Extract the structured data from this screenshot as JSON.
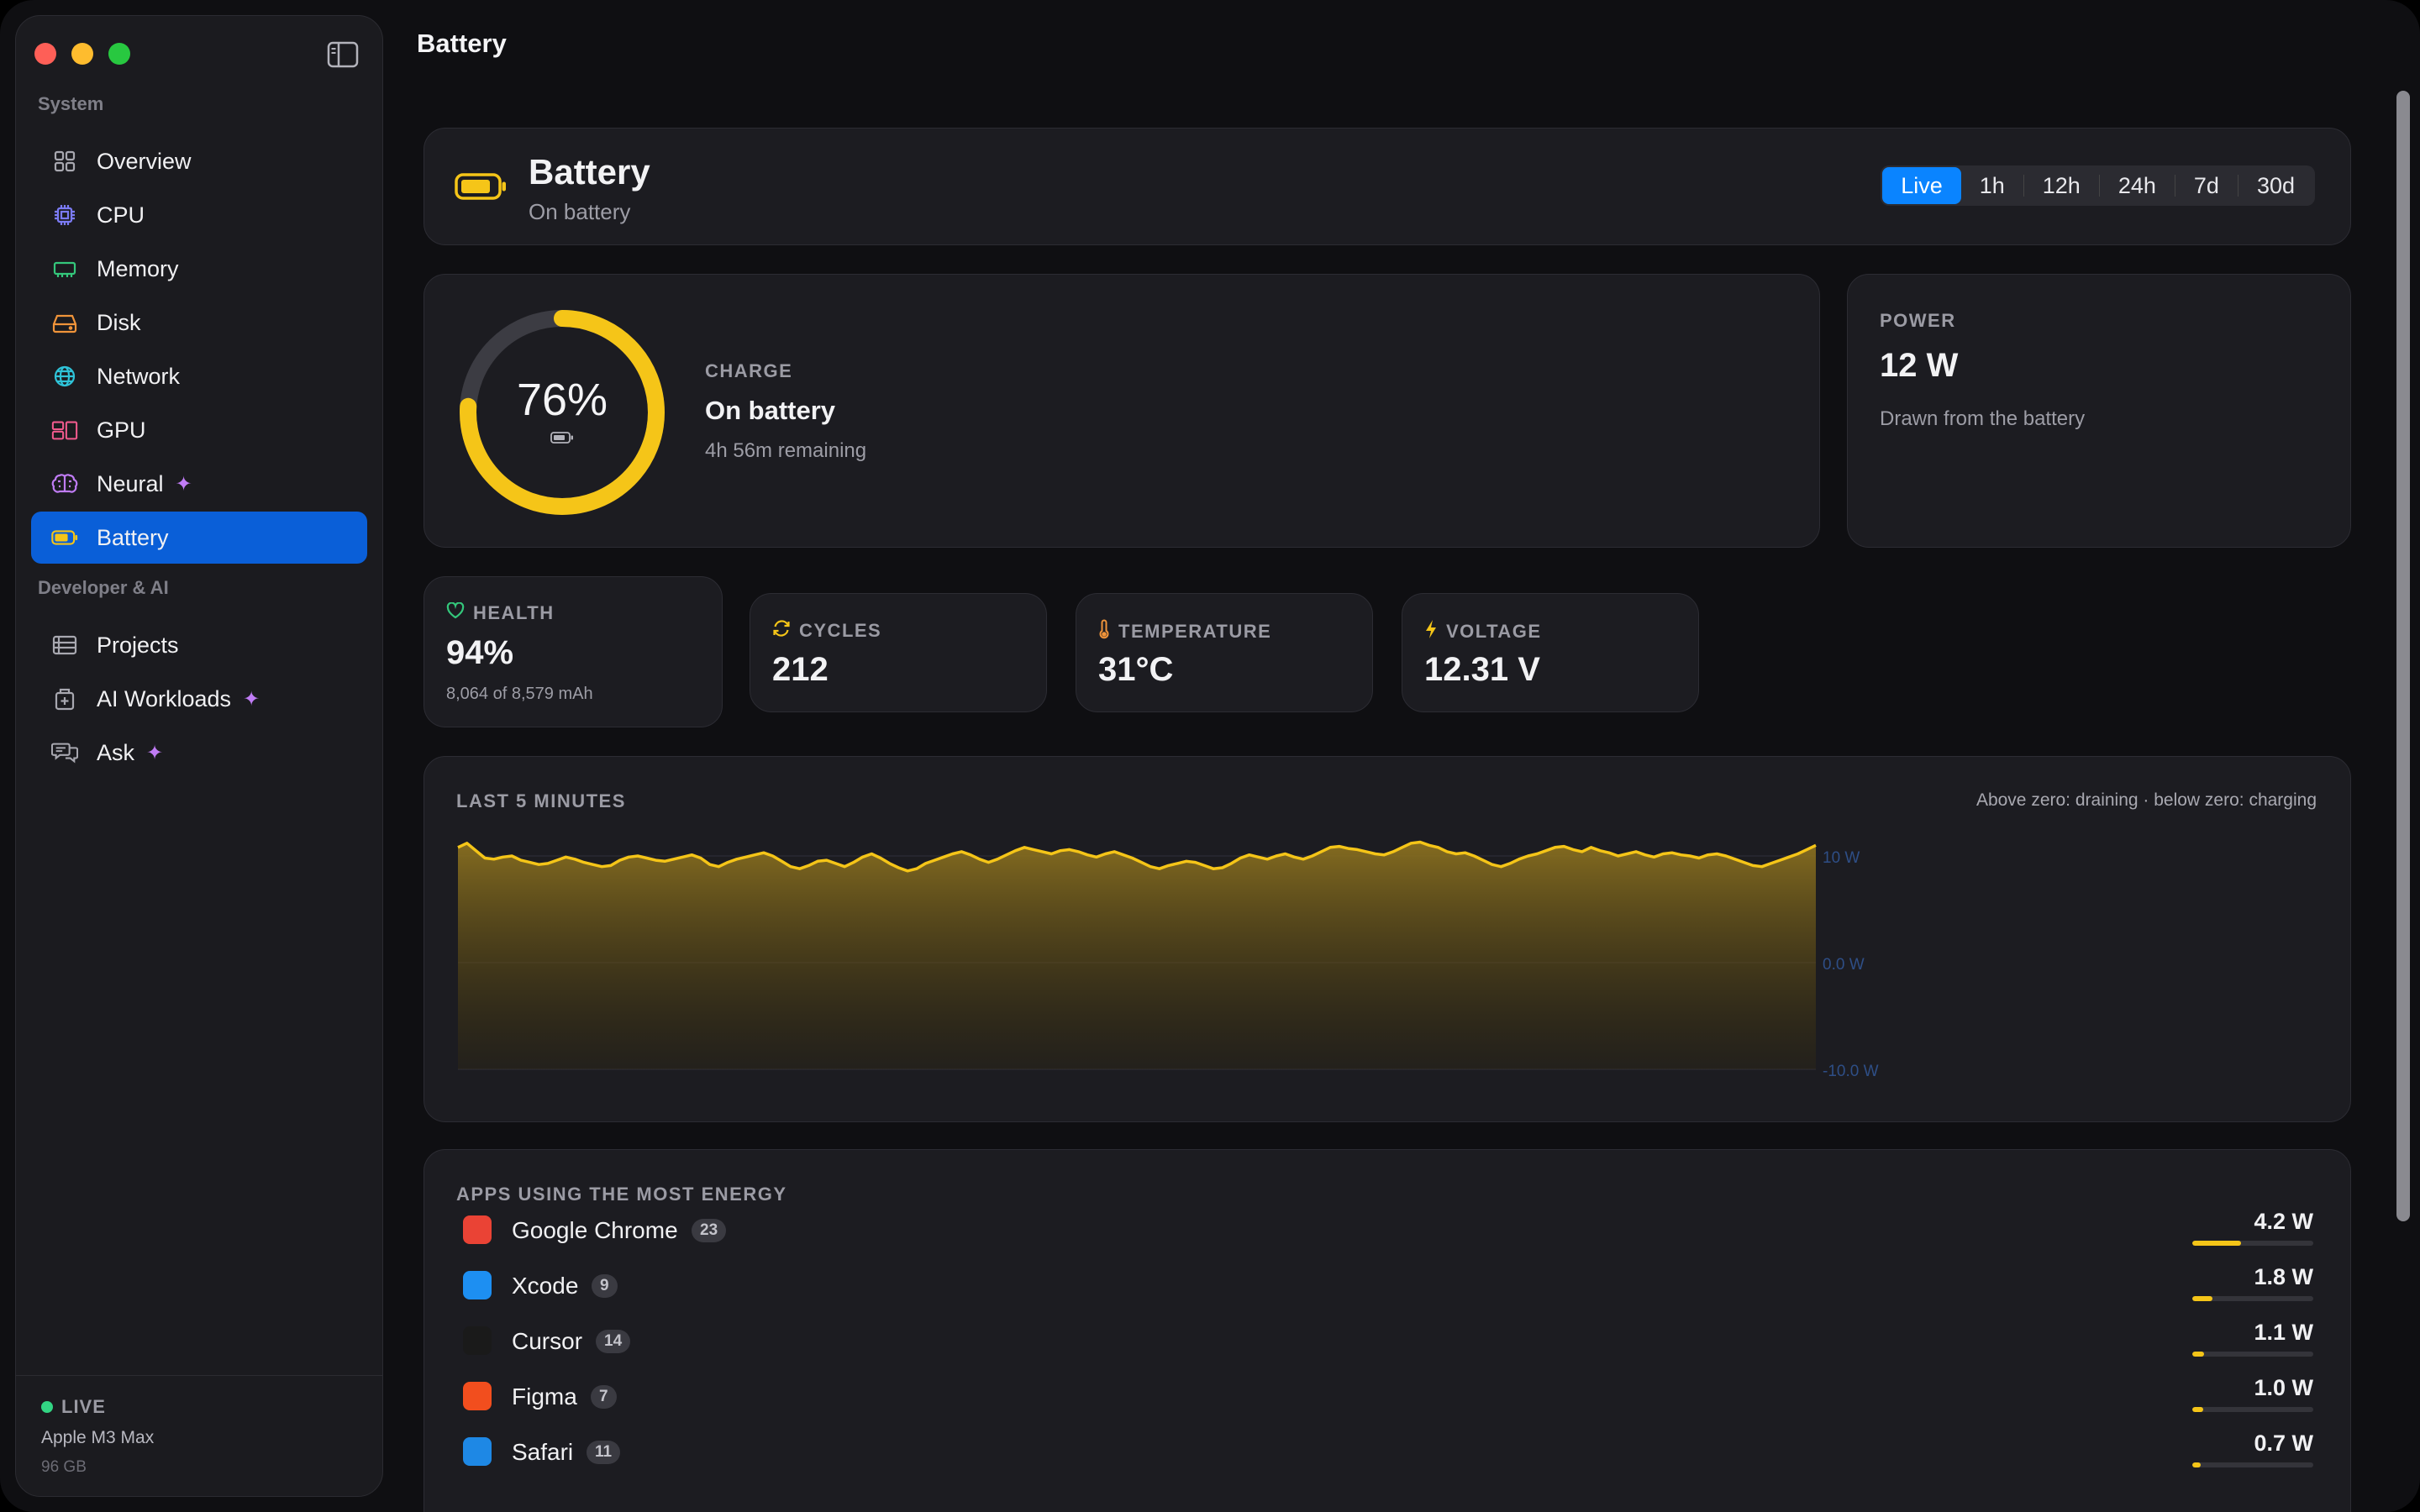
{
  "window": {
    "title": "Battery"
  },
  "sidebar": {
    "sections": [
      {
        "label": "System",
        "items": [
          {
            "label": "Overview",
            "icon": "grid-icon",
            "sparkle": false,
            "active": false
          },
          {
            "label": "CPU",
            "icon": "cpu-icon",
            "sparkle": false,
            "active": false
          },
          {
            "label": "Memory",
            "icon": "memory-icon",
            "sparkle": false,
            "active": false
          },
          {
            "label": "Disk",
            "icon": "disk-icon",
            "sparkle": false,
            "active": false
          },
          {
            "label": "Network",
            "icon": "globe-icon",
            "sparkle": false,
            "active": false
          },
          {
            "label": "GPU",
            "icon": "gpu-icon",
            "sparkle": false,
            "active": false
          },
          {
            "label": "Neural",
            "icon": "brain-icon",
            "sparkle": true,
            "active": false
          },
          {
            "label": "Battery",
            "icon": "battery-icon",
            "sparkle": false,
            "active": true
          }
        ]
      },
      {
        "label": "Developer & AI",
        "items": [
          {
            "label": "Projects",
            "icon": "projects-icon",
            "sparkle": false,
            "active": false
          },
          {
            "label": "AI Workloads",
            "icon": "ai-workloads-icon",
            "sparkle": true,
            "active": false
          },
          {
            "label": "Ask",
            "icon": "chat-icon",
            "sparkle": true,
            "active": false
          }
        ]
      }
    ],
    "sparkle_glyph": "✦",
    "footer": {
      "status": "LIVE",
      "chip": "Apple M3 Max",
      "memory": "96 GB"
    }
  },
  "header": {
    "title": "Battery",
    "subtitle": "On battery",
    "ranges": [
      "Live",
      "1h",
      "12h",
      "24h",
      "7d",
      "30d"
    ],
    "selected_range": "Live"
  },
  "charge": {
    "percent_label": "76%",
    "percent": 76,
    "caption": "CHARGE",
    "state": "On battery",
    "remaining": "4h 56m remaining"
  },
  "power": {
    "caption": "POWER",
    "value": "12 W",
    "subtitle": "Drawn from the battery"
  },
  "stats": {
    "health": {
      "caption": "HEALTH",
      "value": "94%",
      "subtitle": "8,064 of 8,579 mAh"
    },
    "cycles": {
      "caption": "CYCLES",
      "value": "212"
    },
    "temperature": {
      "caption": "TEMPERATURE",
      "value": "31°C"
    },
    "voltage": {
      "caption": "VOLTAGE",
      "value": "12.31 V"
    }
  },
  "chart_caption": "LAST 5 MINUTES",
  "chart_note": "Above zero: draining · below zero: charging",
  "chart_data": {
    "type": "area",
    "title": "LAST 5 MINUTES",
    "ylabel": "",
    "ylim": [
      -10,
      10
    ],
    "y_ticks": [
      "10 W",
      "0.0 W",
      "-10.0 W"
    ],
    "color": "#f5c518",
    "values": [
      10.8,
      11.2,
      10.5,
      9.8,
      9.7,
      9.9,
      10.0,
      9.6,
      9.4,
      9.2,
      9.3,
      9.6,
      9.9,
      9.7,
      9.4,
      9.2,
      9.0,
      9.1,
      9.6,
      9.9,
      10.0,
      9.8,
      9.6,
      9.5,
      9.7,
      9.9,
      10.1,
      9.8,
      9.2,
      9.0,
      9.4,
      9.7,
      9.9,
      10.1,
      10.3,
      10.0,
      9.5,
      9.0,
      8.8,
      9.1,
      9.5,
      9.6,
      9.3,
      9.0,
      9.4,
      9.9,
      10.2,
      9.8,
      9.3,
      8.9,
      8.6,
      8.8,
      9.3,
      9.6,
      9.9,
      10.2,
      10.4,
      10.1,
      9.7,
      9.4,
      9.7,
      10.1,
      10.5,
      10.8,
      10.6,
      10.4,
      10.2,
      10.5,
      10.6,
      10.4,
      10.1,
      9.9,
      10.2,
      10.4,
      10.1,
      9.8,
      9.4,
      9.0,
      8.8,
      9.1,
      9.3,
      9.5,
      9.4,
      9.1,
      8.8,
      8.9,
      9.3,
      9.8,
      10.1,
      9.9,
      9.7,
      10.0,
      10.2,
      9.9,
      9.7,
      10.0,
      10.4,
      10.8,
      10.9,
      10.7,
      10.6,
      10.4,
      10.2,
      10.1,
      10.4,
      10.8,
      11.2,
      11.3,
      11.0,
      10.8,
      10.4,
      10.2,
      10.3,
      10.0,
      9.6,
      9.2,
      9.0,
      9.3,
      9.7,
      10.0,
      10.2,
      10.5,
      10.8,
      10.9,
      10.6,
      10.4,
      10.8,
      10.5,
      10.3,
      10.0,
      10.2,
      10.4,
      10.1,
      9.9,
      10.2,
      10.3,
      10.1,
      10.0,
      9.8,
      10.1,
      10.2,
      10.0,
      9.7,
      9.4,
      9.1,
      9.0,
      9.3,
      9.6,
      9.9,
      10.2,
      10.6,
      11.0
    ]
  },
  "apps": {
    "caption": "APPS USING THE MOST ENERGY",
    "rows": [
      {
        "name": "Google Chrome",
        "count": "23",
        "power": "4.2 W",
        "fraction": 0.4,
        "icon": "chrome-icon",
        "color": "#ea4335"
      },
      {
        "name": "Xcode",
        "count": "9",
        "power": "1.8 W",
        "fraction": 0.17,
        "icon": "xcode-icon",
        "color": "#1d8ff2"
      },
      {
        "name": "Cursor",
        "count": "14",
        "power": "1.1 W",
        "fraction": 0.1,
        "icon": "cursor-icon",
        "color": "#1a1a1a"
      },
      {
        "name": "Figma",
        "count": "7",
        "power": "1.0 W",
        "fraction": 0.09,
        "icon": "figma-icon",
        "color": "#f24e1e"
      },
      {
        "name": "Safari",
        "count": "11",
        "power": "0.7 W",
        "fraction": 0.07,
        "icon": "safari-icon",
        "color": "#1e88e5"
      }
    ]
  }
}
